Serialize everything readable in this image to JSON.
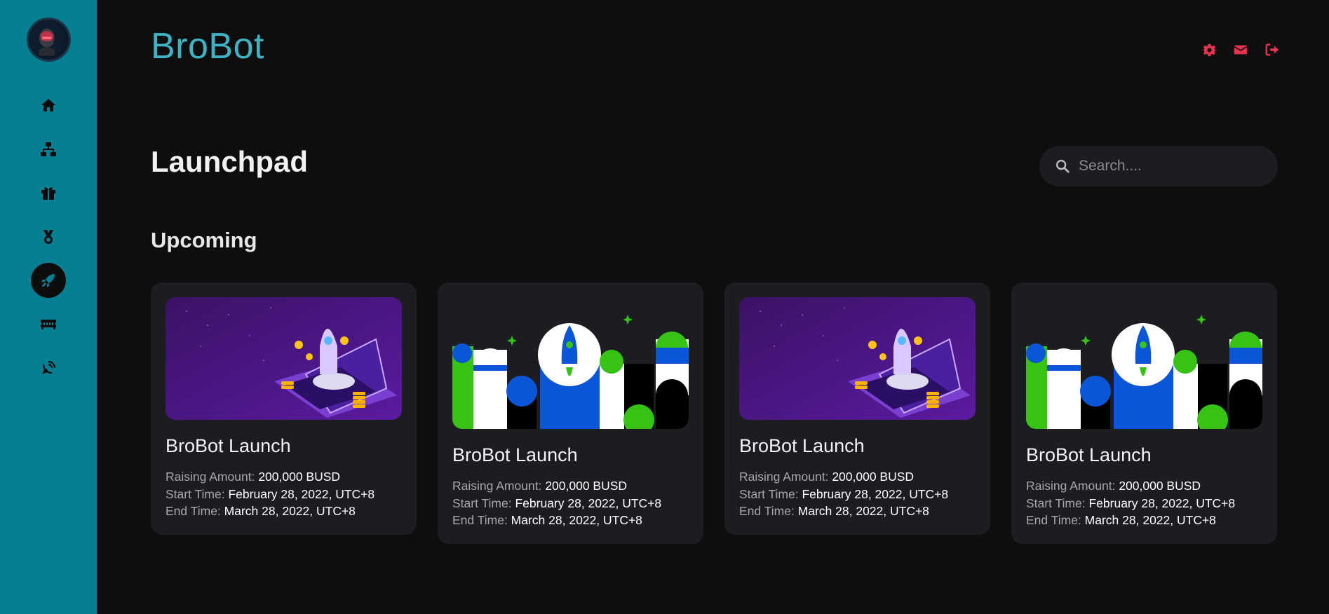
{
  "app": {
    "brand": "BroBot"
  },
  "sidebar": {
    "items": [
      {
        "name": "home-icon"
      },
      {
        "name": "sitemap-icon"
      },
      {
        "name": "gift-icon"
      },
      {
        "name": "medal-icon"
      },
      {
        "name": "rocket-icon",
        "active": true
      },
      {
        "name": "bridge-icon"
      },
      {
        "name": "satellite-dish-icon"
      }
    ]
  },
  "header": {
    "icons": [
      "gear-icon",
      "envelope-icon",
      "sign-out-icon"
    ],
    "accent": "#e5334f"
  },
  "page": {
    "title": "Launchpad"
  },
  "search": {
    "placeholder": "Search...."
  },
  "section": {
    "title": "Upcoming"
  },
  "cards": [
    {
      "title": "BroBot Launch",
      "image": "purple-laptop-rocket",
      "raising_label": "Raising Amount:",
      "raising": "200,000 BUSD",
      "start_label": "Start Time:",
      "start": "February 28, 2022, UTC+8",
      "end_label": "End Time:",
      "end": "March 28, 2022, UTC+8"
    },
    {
      "title": "BroBot Launch",
      "image": "blue-green-rocket",
      "raising_label": "Raising Amount:",
      "raising": "200,000 BUSD",
      "start_label": "Start Time:",
      "start": "February 28, 2022, UTC+8",
      "end_label": "End Time:",
      "end": "March 28, 2022, UTC+8"
    },
    {
      "title": "BroBot Launch",
      "image": "purple-laptop-rocket",
      "raising_label": "Raising Amount:",
      "raising": "200,000 BUSD",
      "start_label": "Start Time:",
      "start": "February 28, 2022, UTC+8",
      "end_label": "End Time:",
      "end": "March 28, 2022, UTC+8"
    },
    {
      "title": "BroBot Launch",
      "image": "blue-green-rocket",
      "raising_label": "Raising Amount:",
      "raising": "200,000 BUSD",
      "start_label": "Start Time:",
      "start": "February 28, 2022, UTC+8",
      "end_label": "End Time:",
      "end": "March 28, 2022, UTC+8"
    }
  ],
  "colors": {
    "sidebar": "#067f92",
    "background": "#0e0e0f",
    "card": "#1c1d20",
    "brand": "#3fb3c4"
  }
}
